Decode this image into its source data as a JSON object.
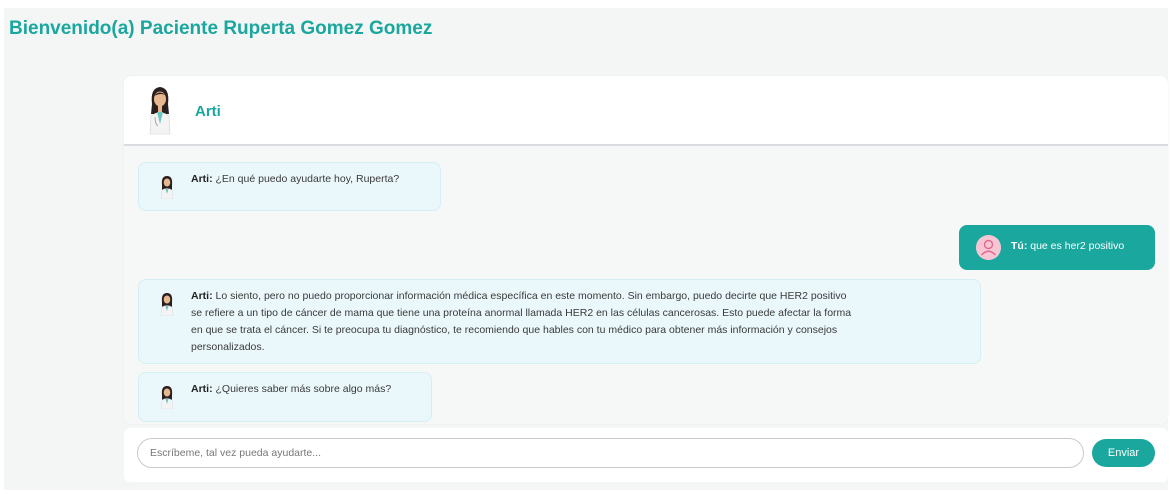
{
  "welcome": "Bienvenido(a) Paciente Ruperta Gomez Gomez",
  "chat": {
    "assistant_name": "Arti",
    "messages": [
      {
        "sender": "Arti:",
        "text": " ¿En qué puedo ayudarte hoy, Ruperta?"
      },
      {
        "sender": "Tú:",
        "text": " que es her2 positivo"
      },
      {
        "sender": "Arti:",
        "line1": " Lo siento, pero no puedo proporcionar información médica específica en este momento. Sin embargo, puedo decirte que HER2 positivo",
        "line2": "se refiere a un tipo de cáncer de mama que tiene una proteína anormal llamada HER2 en las células cancerosas. Esto puede afectar la forma",
        "line3": "en que se trata el cáncer. Si te preocupa tu diagnóstico, te recomiendo que hables con tu médico para obtener más información y consejos",
        "line4": "personalizados."
      },
      {
        "sender": "Arti:",
        "text": " ¿Quieres saber más sobre algo más?"
      }
    ]
  },
  "input": {
    "placeholder": "Escríbeme, tal vez pueda ayudarte...",
    "send_label": "Enviar"
  },
  "colors": {
    "accent": "#1aa89e",
    "assistant_bubble": "#eaf8fb",
    "user_avatar": "#f7c6d4"
  },
  "icons": {
    "assistant_avatar": "doctor-avatar-icon",
    "user_avatar": "user-avatar-icon"
  }
}
